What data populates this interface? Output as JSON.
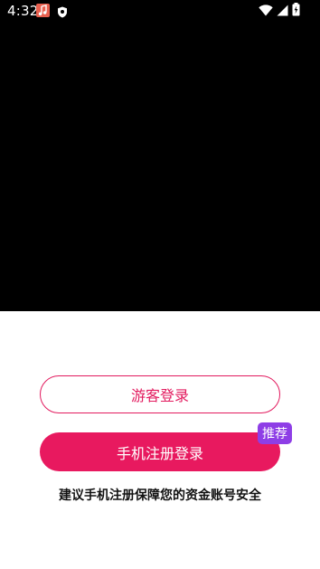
{
  "status_bar": {
    "time": "4:32",
    "icons": [
      "music-notification-icon",
      "shield-notification-icon",
      "wifi-icon",
      "signal-icon",
      "battery-charging-icon"
    ]
  },
  "login": {
    "guest_label": "游客登录",
    "phone_label": "手机注册登录",
    "badge_label": "推荐",
    "hint": "建议手机注册保障您的资金账号安全"
  },
  "colors": {
    "top_background": "#000000",
    "accent": "#e8195f",
    "badge": "#8e3ee6"
  }
}
